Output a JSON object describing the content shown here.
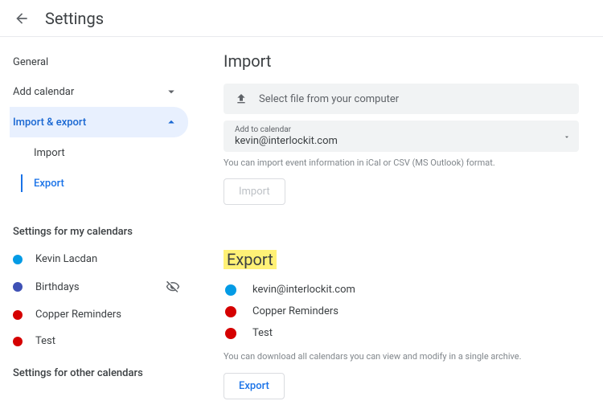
{
  "header": {
    "title": "Settings"
  },
  "sidebar": {
    "nav": [
      {
        "label": "General",
        "expandable": false
      },
      {
        "label": "Add calendar",
        "expandable": true,
        "expanded": false
      },
      {
        "label": "Import & export",
        "expandable": true,
        "expanded": true,
        "active": true,
        "children": [
          {
            "label": "Import",
            "active": false
          },
          {
            "label": "Export",
            "active": true
          }
        ]
      }
    ],
    "my_calendars_heading": "Settings for my calendars",
    "my_calendars": [
      {
        "label": "Kevin Lacdan",
        "color": "#039be5",
        "hidden": false
      },
      {
        "label": "Birthdays",
        "color": "#3f51b5",
        "hidden": true
      },
      {
        "label": "Copper Reminders",
        "color": "#d50000",
        "hidden": false
      },
      {
        "label": "Test",
        "color": "#d50000",
        "hidden": false
      }
    ],
    "other_calendars_heading": "Settings for other calendars"
  },
  "import": {
    "title": "Import",
    "upload_label": "Select file from your computer",
    "calendar_select_label": "Add to calendar",
    "calendar_select_value": "kevin@interlockit.com",
    "help": "You can import event information in iCal or CSV (MS Outlook) format.",
    "button": "Import"
  },
  "export": {
    "title": "Export",
    "items": [
      {
        "label": "kevin@interlockit.com",
        "color": "#039be5"
      },
      {
        "label": "Copper Reminders",
        "color": "#d50000"
      },
      {
        "label": "Test",
        "color": "#d50000"
      }
    ],
    "help": "You can download all calendars you can view and modify in a single archive.",
    "button": "Export"
  }
}
